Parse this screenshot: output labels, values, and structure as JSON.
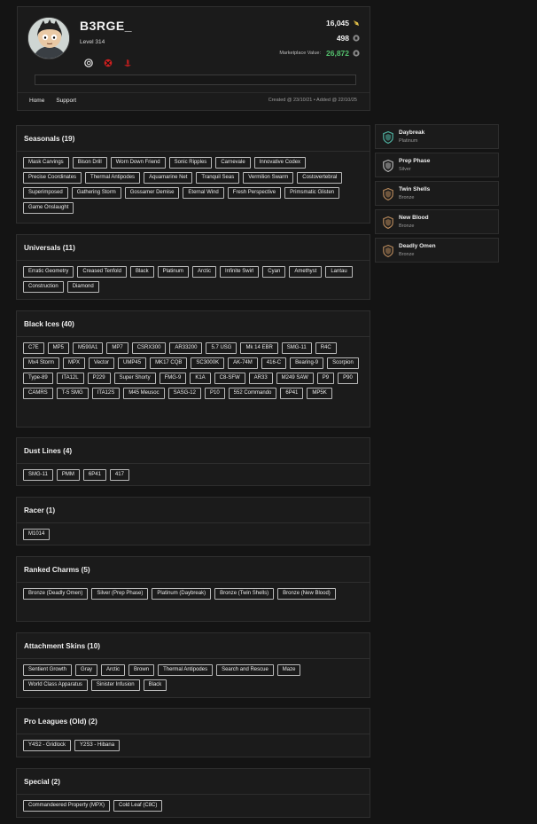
{
  "profile": {
    "username": "B3RGE_",
    "level": "Level 314",
    "credits": "16,045",
    "renown": "498",
    "marketplace_label": "Marketplace Value:",
    "marketplace_value": "26,872",
    "platforms": [
      "ubisoft-icon",
      "xbox-icon",
      "playstation-icon"
    ],
    "nav": [
      "Home",
      "Support"
    ],
    "dates": "Created @ 23/10/21 • Added @ 22/10/25"
  },
  "sections": [
    {
      "title": "Seasonals (19)",
      "tags": [
        "Mask Carvings",
        "Bison Drill",
        "Worn Down Friend",
        "Sonic Ripples",
        "Carnevale",
        "Innovative Codex",
        "Precise Coordinates",
        "Thermal Antipodes",
        "Aquamarine Net",
        "Tranquil Seas",
        "Vermilion Swarm",
        "Costovertebral",
        "Superimposed",
        "Gathering Storm",
        "Gossamer Demise",
        "Eternal Wind",
        "Fresh Perspective",
        "Primsmatic Glisten",
        "Game Onslaught"
      ]
    },
    {
      "title": "Universals (11)",
      "tags": [
        "Erratic Geometry",
        "Creased Tenfold",
        "Black",
        "Platinum",
        "Arctic",
        "Infinite Swirl",
        "Cyan",
        "Amethyst",
        "Lantau",
        "Construction",
        "Diamond"
      ]
    },
    {
      "title": "Black Ices (40)",
      "tags": [
        "C7E",
        "MP5",
        "M590A1",
        "MP7",
        "CSRX300",
        "AR33200",
        "5.7 USG",
        "Mk 14 EBR",
        "SMG-11",
        "R4C",
        "Mx4 Storm",
        "MPX",
        "Vector",
        "UMP45",
        "MK17 CQB",
        "SC3000K",
        "AK-74M",
        "416-C",
        "Bearing-9",
        "Scorpion",
        "Type-89",
        "ITA12L",
        "P229",
        "Super Shorty",
        "FMG-9",
        "K1A",
        "C8-SFW",
        "AR33",
        "M249 SAW",
        "P9",
        "P90",
        "CAMRS",
        "T-5 SMG",
        "ITA12S",
        "M45 Meusoc",
        "SASG-12",
        "P10",
        "552 Commando",
        "6P41",
        "MP5K"
      ]
    },
    {
      "title": "Dust Lines (4)",
      "tags": [
        "SMG-11",
        "PMM",
        "6P41",
        "417"
      ]
    },
    {
      "title": "Racer (1)",
      "tags": [
        "M1014"
      ]
    },
    {
      "title": "Ranked Charms (5)",
      "tags": [
        "Bronze (Deadly Omen)",
        "Silver (Prep Phase)",
        "Platinum (Daybreak)",
        "Bronze (Twin Shells)",
        "Bronze (New Blood)"
      ]
    },
    {
      "title": "Attachment Skins (10)",
      "tags": [
        "Sentient Growth",
        "Gray",
        "Arctic",
        "Brown",
        "Thermal Antipodes",
        "Search and Rescue",
        "Maze",
        "World Class Apparatus",
        "Sinister Infusion",
        "Black"
      ]
    },
    {
      "title": "Pro Leagues (Old) (2)",
      "tags": [
        "Y4S2 - Gridlock",
        "Y2S3 - Hibana"
      ]
    },
    {
      "title": "Special (2)",
      "tags": [
        "Commandeered Property (MPX)",
        "Cold Leaf (C8C)"
      ]
    }
  ],
  "charms": [
    {
      "name": "Daybreak",
      "tier": "Platinum",
      "color": "#4fb3a2"
    },
    {
      "name": "Prep Phase",
      "tier": "Silver",
      "color": "#b5b5b5"
    },
    {
      "name": "Twin Shells",
      "tier": "Bronze",
      "color": "#b5875a"
    },
    {
      "name": "New Blood",
      "tier": "Bronze",
      "color": "#b5875a"
    },
    {
      "name": "Deadly Omen",
      "tier": "Bronze",
      "color": "#b5875a"
    }
  ],
  "colors": {
    "accent_green": "#54c26e",
    "credit_gold": "#e3c24b",
    "renown_gray": "#8e8e8e",
    "xbox_red": "#d12020",
    "ps_red": "#b01e1e"
  }
}
